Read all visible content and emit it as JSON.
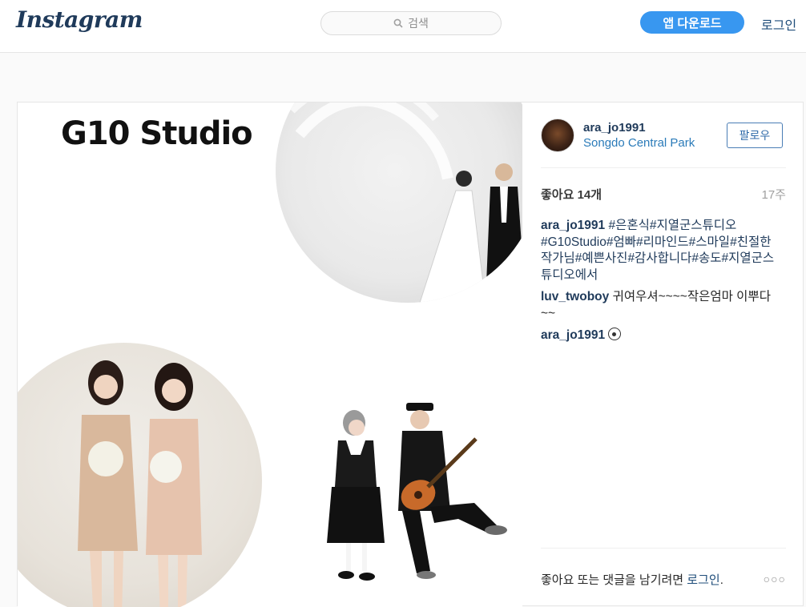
{
  "nav": {
    "logo": "Instagram",
    "search_placeholder": "검색",
    "download_button": "앱 다운로드",
    "login_link": "로그인"
  },
  "post": {
    "image_caption_text": "G10 Studio",
    "author": {
      "username": "ara_jo1991",
      "location": "Songdo Central Park"
    },
    "follow_button": "팔로우",
    "likes": "좋아요 14개",
    "age": "17주",
    "comments": [
      {
        "username": "ara_jo1991",
        "text": "#은혼식#지열군스튜디오#G10Studio#엄빠#리마인드#스마일#친절한작가님#예쁜사진#감사합니다#송도#지열군스튜디오에서"
      },
      {
        "username": "luv_twoboy",
        "text": "귀여우셔~~~~작은엄마 이뿌다~~"
      },
      {
        "username": "ara_jo1991",
        "text": ""
      }
    ],
    "footer_prefix": "좋아요 또는 댓글을 남기려면 ",
    "footer_link": "로그인",
    "footer_suffix": ".",
    "more_menu": "○○○"
  }
}
